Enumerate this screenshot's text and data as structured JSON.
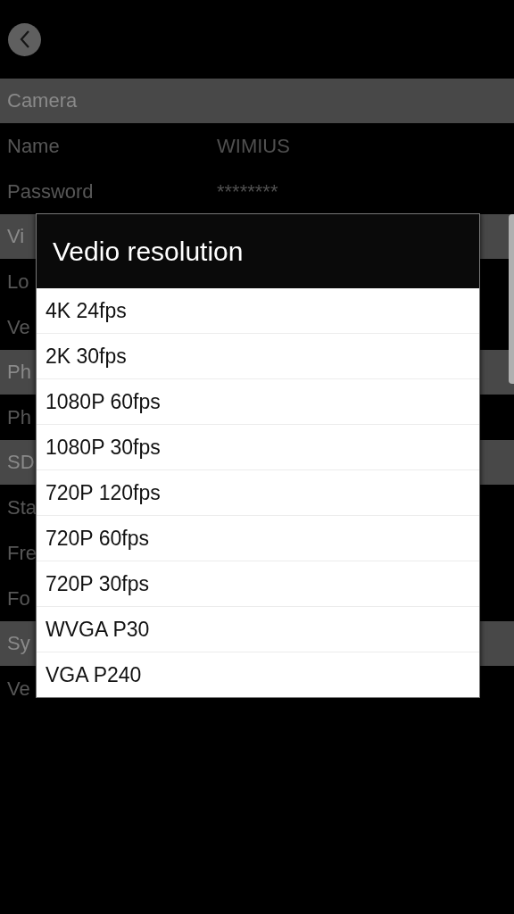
{
  "settings": [
    {
      "kind": "section",
      "label": "Camera"
    },
    {
      "kind": "row",
      "label": "Name",
      "value": "WIMIUS"
    },
    {
      "kind": "row",
      "label": "Password",
      "value": "********"
    },
    {
      "kind": "section",
      "label": "Vi"
    },
    {
      "kind": "row",
      "label": "Lo"
    },
    {
      "kind": "row",
      "label": "Ve"
    },
    {
      "kind": "section",
      "label": "Ph"
    },
    {
      "kind": "row",
      "label": "Ph"
    },
    {
      "kind": "section",
      "label": "SD"
    },
    {
      "kind": "row",
      "label": "Sta"
    },
    {
      "kind": "row",
      "label": "Fre"
    },
    {
      "kind": "row",
      "label": "Fo"
    },
    {
      "kind": "section",
      "label": "Sy"
    },
    {
      "kind": "row",
      "label": "Ve"
    }
  ],
  "dialog": {
    "title": "Vedio resolution",
    "options": [
      "4K 24fps",
      "2K 30fps",
      "1080P 60fps",
      "1080P 30fps",
      "720P 120fps",
      "720P 60fps",
      "720P 30fps",
      "WVGA P30",
      "VGA P240"
    ]
  }
}
